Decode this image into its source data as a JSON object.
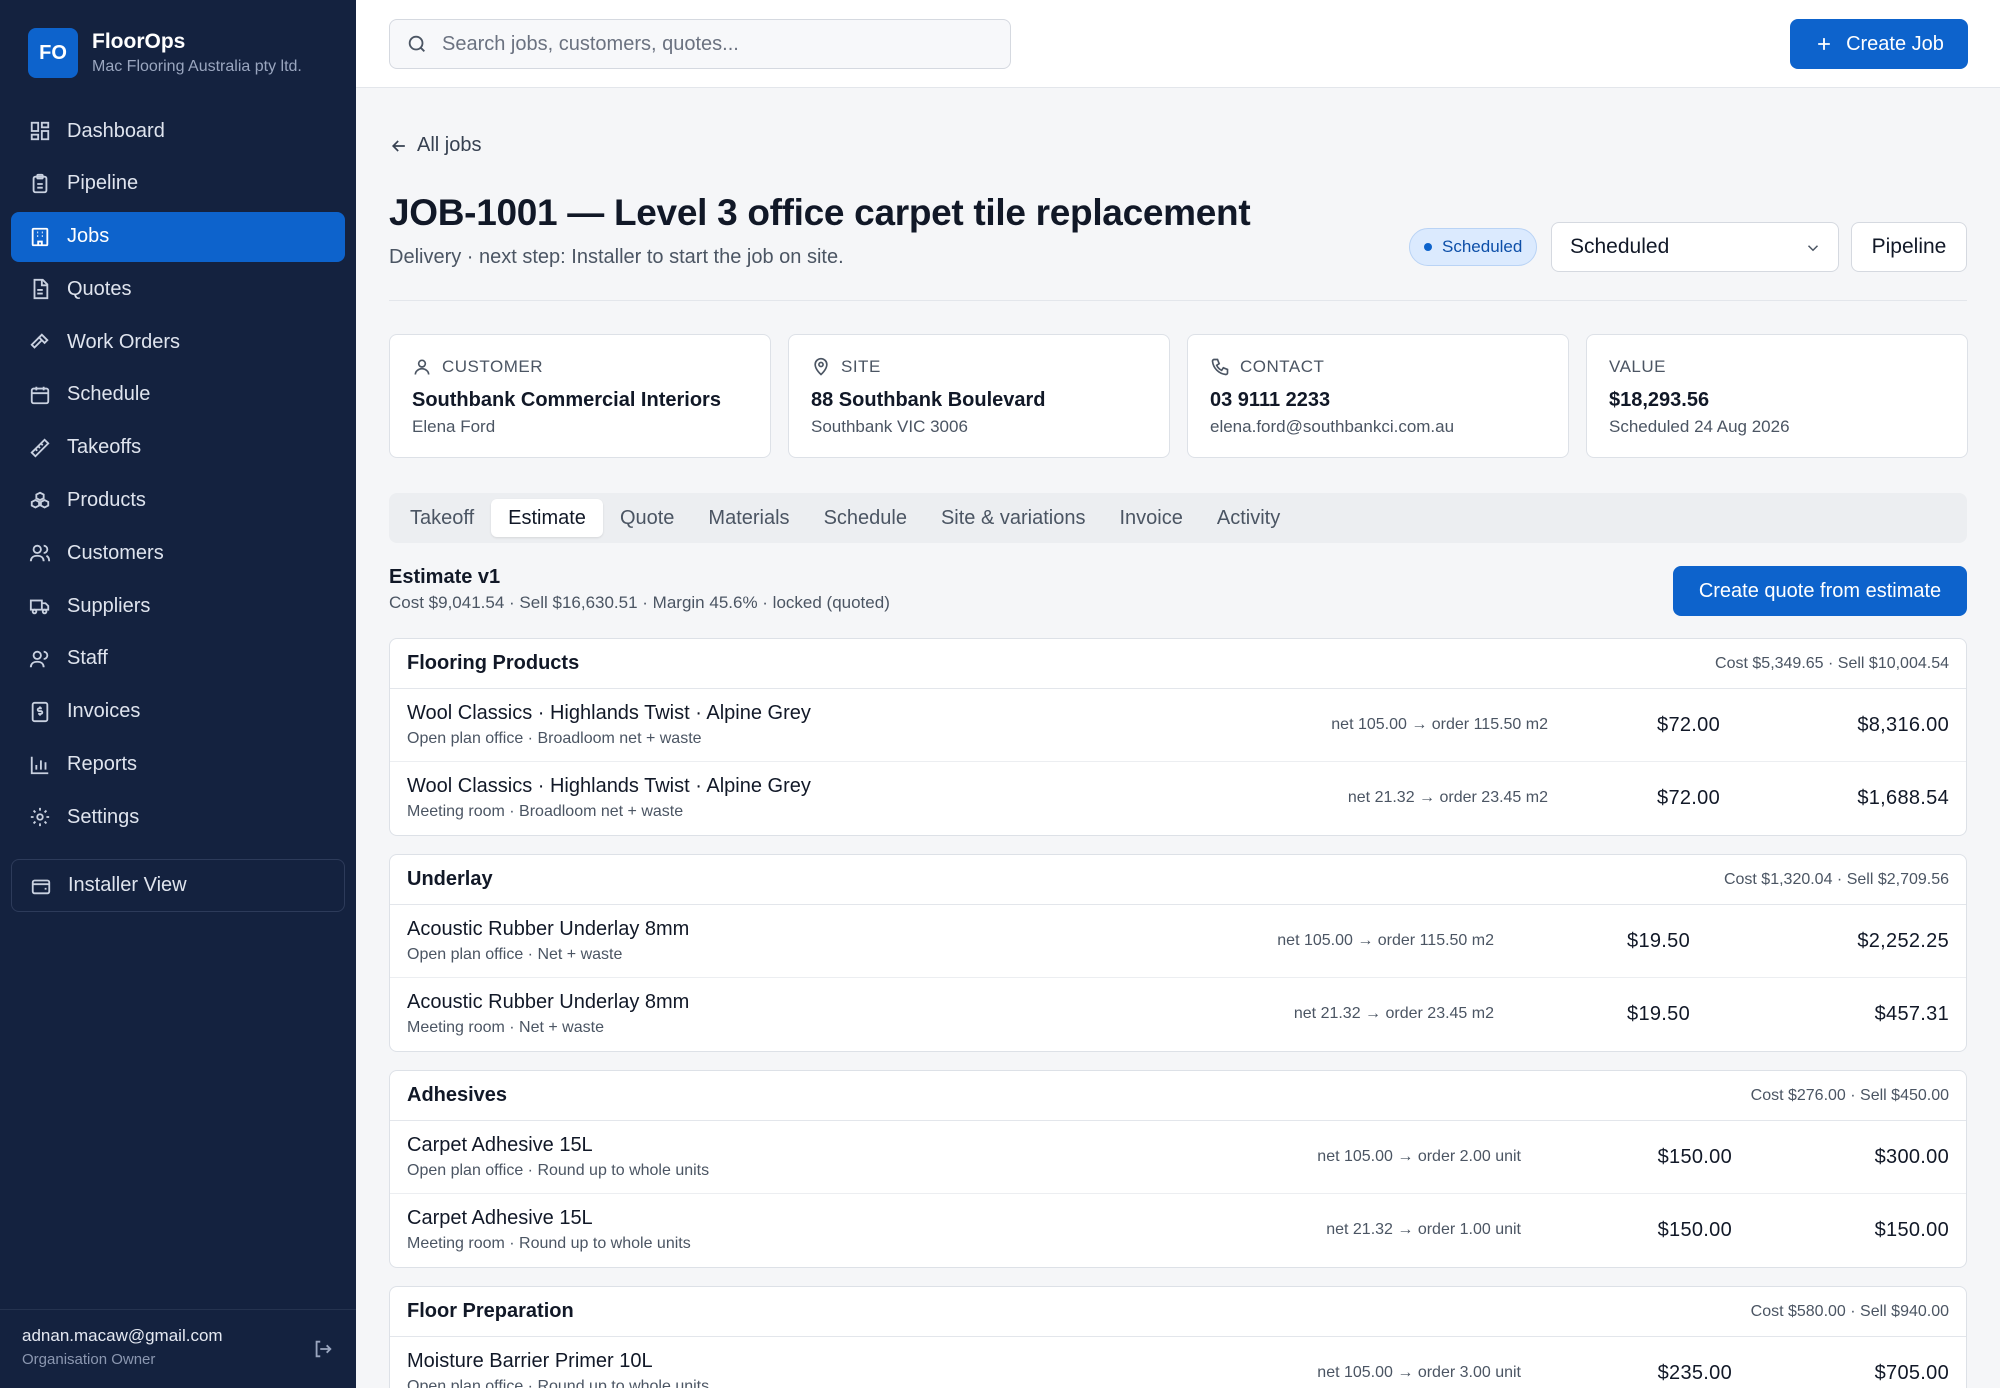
{
  "brand": {
    "initials": "FO",
    "name": "FloorOps",
    "org": "Mac Flooring Australia pty ltd."
  },
  "nav": [
    {
      "label": "Dashboard",
      "icon": "dashboard-icon",
      "active": false
    },
    {
      "label": "Pipeline",
      "icon": "clipboard-icon",
      "active": false
    },
    {
      "label": "Jobs",
      "icon": "building-icon",
      "active": true
    },
    {
      "label": "Quotes",
      "icon": "document-icon",
      "active": false
    },
    {
      "label": "Work Orders",
      "icon": "hammer-icon",
      "active": false
    },
    {
      "label": "Schedule",
      "icon": "calendar-icon",
      "active": false
    },
    {
      "label": "Takeoffs",
      "icon": "ruler-icon",
      "active": false
    },
    {
      "label": "Products",
      "icon": "boxes-icon",
      "active": false
    },
    {
      "label": "Customers",
      "icon": "users-icon",
      "active": false
    },
    {
      "label": "Suppliers",
      "icon": "truck-icon",
      "active": false
    },
    {
      "label": "Staff",
      "icon": "staff-icon",
      "active": false
    },
    {
      "label": "Invoices",
      "icon": "invoice-icon",
      "active": false
    },
    {
      "label": "Reports",
      "icon": "bar-chart-icon",
      "active": false
    },
    {
      "label": "Settings",
      "icon": "gear-icon",
      "active": false
    }
  ],
  "installer_view": "Installer View",
  "user": {
    "email": "adnan.macaw@gmail.com",
    "role": "Organisation Owner"
  },
  "search": {
    "placeholder": "Search jobs, customers, quotes..."
  },
  "create_job": "Create Job",
  "back_link": "All jobs",
  "job": {
    "title": "JOB-1001 — Level 3 office carpet tile replacement",
    "subtitle": "Delivery · next step: Installer to start the job on site.",
    "status_badge": "Scheduled",
    "status_select": "Scheduled",
    "pipeline_button": "Pipeline"
  },
  "cards": [
    {
      "label": "CUSTOMER",
      "icon": "person-icon",
      "value": "Southbank Commercial Interiors",
      "sub": "Elena Ford"
    },
    {
      "label": "SITE",
      "icon": "map-pin-icon",
      "value": "88 Southbank Boulevard",
      "sub": "Southbank VIC 3006"
    },
    {
      "label": "CONTACT",
      "icon": "phone-icon",
      "value": "03 9111 2233",
      "sub": "elena.ford@southbankci.com.au"
    },
    {
      "label": "VALUE",
      "icon": "",
      "value": "$18,293.56",
      "sub": "Scheduled 24 Aug 2026"
    }
  ],
  "tabs": [
    {
      "label": "Takeoff",
      "active": false
    },
    {
      "label": "Estimate",
      "active": true
    },
    {
      "label": "Quote",
      "active": false
    },
    {
      "label": "Materials",
      "active": false
    },
    {
      "label": "Schedule",
      "active": false
    },
    {
      "label": "Site & variations",
      "active": false
    },
    {
      "label": "Invoice",
      "active": false
    },
    {
      "label": "Activity",
      "active": false
    }
  ],
  "estimate": {
    "title": "Estimate v1",
    "summary": "Cost $9,041.54 · Sell $16,630.51 · Margin 45.6% · locked (quoted)",
    "create_quote": "Create quote from estimate",
    "sections": [
      {
        "name": "Flooring Products",
        "totals": "Cost $5,349.65 · Sell $10,004.54",
        "rows": [
          {
            "name": "Wool Classics · Highlands Twist · Alpine Grey",
            "desc": "Open plan office · Broadloom net + waste",
            "qty": "net 105.00 → order 115.50 m2",
            "rate": "$72.00",
            "total": "$8,316.00"
          },
          {
            "name": "Wool Classics · Highlands Twist · Alpine Grey",
            "desc": "Meeting room · Broadloom net + waste",
            "qty": "net 21.32 → order 23.45 m2",
            "rate": "$72.00",
            "total": "$1,688.54"
          }
        ]
      },
      {
        "name": "Underlay",
        "totals": "Cost $1,320.04 · Sell $2,709.56",
        "rows": [
          {
            "name": "Acoustic Rubber Underlay 8mm",
            "desc": "Open plan office · Net + waste",
            "qty": "net 105.00 → order 115.50 m2",
            "rate": "$19.50",
            "total": "$2,252.25"
          },
          {
            "name": "Acoustic Rubber Underlay 8mm",
            "desc": "Meeting room · Net + waste",
            "qty": "net 21.32 → order 23.45 m2",
            "rate": "$19.50",
            "total": "$457.31"
          }
        ]
      },
      {
        "name": "Adhesives",
        "totals": "Cost $276.00 · Sell $450.00",
        "rows": [
          {
            "name": "Carpet Adhesive 15L",
            "desc": "Open plan office · Round up to whole units",
            "qty": "net 105.00 → order 2.00 unit",
            "rate": "$150.00",
            "total": "$300.00"
          },
          {
            "name": "Carpet Adhesive 15L",
            "desc": "Meeting room · Round up to whole units",
            "qty": "net 21.32 → order 1.00 unit",
            "rate": "$150.00",
            "total": "$150.00"
          }
        ]
      },
      {
        "name": "Floor Preparation",
        "totals": "Cost $580.00 · Sell $940.00",
        "rows": [
          {
            "name": "Moisture Barrier Primer 10L",
            "desc": "Open plan office · Round up to whole units",
            "qty": "net 105.00 → order 3.00 unit",
            "rate": "$235.00",
            "total": "$705.00"
          }
        ]
      }
    ]
  }
}
